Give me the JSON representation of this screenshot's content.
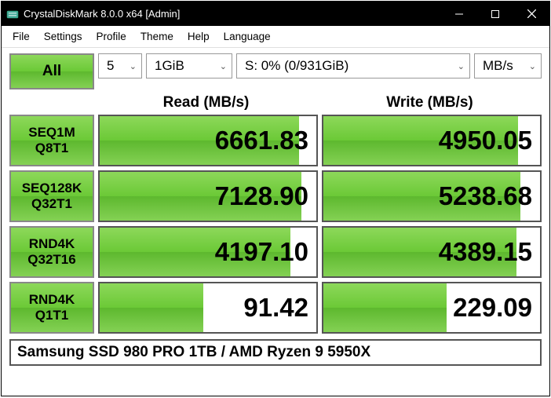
{
  "window": {
    "title": "CrystalDiskMark 8.0.0 x64 [Admin]"
  },
  "menu": {
    "file": "File",
    "settings": "Settings",
    "profile": "Profile",
    "theme": "Theme",
    "help": "Help",
    "language": "Language"
  },
  "controls": {
    "all": "All",
    "runs": "5",
    "size": "1GiB",
    "drive": "S: 0% (0/931GiB)",
    "unit": "MB/s"
  },
  "headers": {
    "read": "Read (MB/s)",
    "write": "Write (MB/s)"
  },
  "rows": [
    {
      "l1": "SEQ1M",
      "l2": "Q8T1",
      "read": "6661.83",
      "write": "4950.05",
      "rbar": 92,
      "wbar": 90
    },
    {
      "l1": "SEQ128K",
      "l2": "Q32T1",
      "read": "7128.90",
      "write": "5238.68",
      "rbar": 93,
      "wbar": 91
    },
    {
      "l1": "RND4K",
      "l2": "Q32T16",
      "read": "4197.10",
      "write": "4389.15",
      "rbar": 88,
      "wbar": 89
    },
    {
      "l1": "RND4K",
      "l2": "Q1T1",
      "read": "91.42",
      "write": "229.09",
      "rbar": 48,
      "wbar": 57
    }
  ],
  "footer": "Samsung SSD 980 PRO 1TB / AMD Ryzen 9 5950X"
}
